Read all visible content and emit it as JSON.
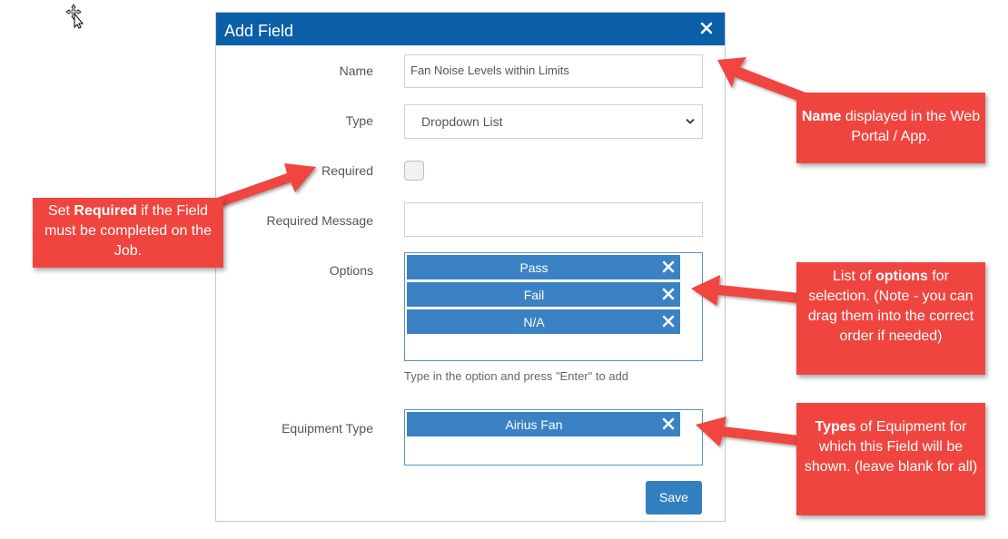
{
  "dialog": {
    "title": "Add Field",
    "fields": {
      "name_label": "Name",
      "name_value": "Fan Noise Levels within Limits",
      "type_label": "Type",
      "type_value": "Dropdown List",
      "required_label": "Required",
      "required_checked": false,
      "required_message_label": "Required Message",
      "required_message_value": "",
      "options_label": "Options",
      "options": [
        "Pass",
        "Fail",
        "N/A"
      ],
      "options_hint": "Type in the option and press \"Enter\" to add",
      "equipment_type_label": "Equipment Type",
      "equipment_types": [
        "Airius Fan"
      ]
    },
    "save_label": "Save"
  },
  "callouts": {
    "name": {
      "bold": "Name",
      "text": " displayed in the Web Portal / App."
    },
    "required": {
      "pre": "Set ",
      "bold": "Required",
      "text": " if the Field must be completed on the Job."
    },
    "options": {
      "pre": "List of ",
      "bold": "options",
      "text": " for selection. (Note - you can drag them into the correct order if needed)"
    },
    "types": {
      "bold": "Types",
      "text": " of Equipment for which this Field will be shown. (leave blank for all)"
    }
  },
  "colors": {
    "header": "#0b5ea8",
    "tag": "#3b82c4",
    "save": "#3380c0",
    "callout": "#f0453f"
  },
  "icons": [
    "move-cursor-icon",
    "close-icon",
    "chevron-down-icon",
    "remove-tag-icon"
  ]
}
